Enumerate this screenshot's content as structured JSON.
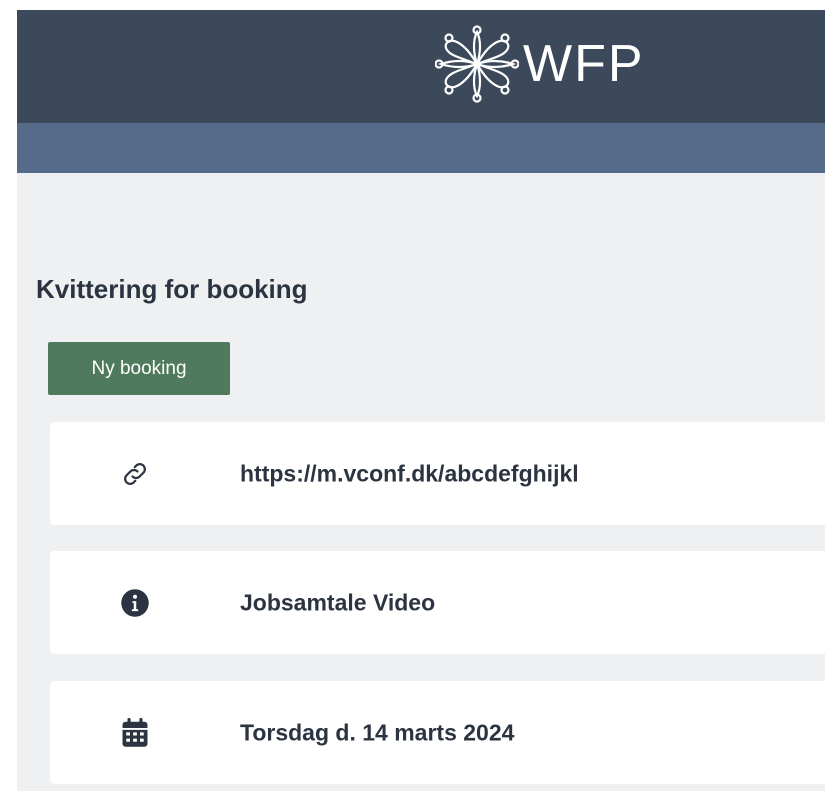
{
  "header": {
    "logo_text": "WFP"
  },
  "receipt": {
    "title": "Kvittering for booking",
    "new_booking_label": "Ny booking",
    "items": [
      {
        "icon": "link-icon",
        "text": "https://m.vconf.dk/abcdefghijkl"
      },
      {
        "icon": "info-icon",
        "text": "Jobsamtale Video"
      },
      {
        "icon": "calendar-icon",
        "text": "Torsdag d. 14 marts 2024"
      }
    ]
  },
  "colors": {
    "header_bg": "#3c495b",
    "subbar_bg": "#566b89",
    "page_bg": "#eef0f2",
    "button_bg": "#4f7a5e",
    "text_dark": "#2b3440"
  }
}
